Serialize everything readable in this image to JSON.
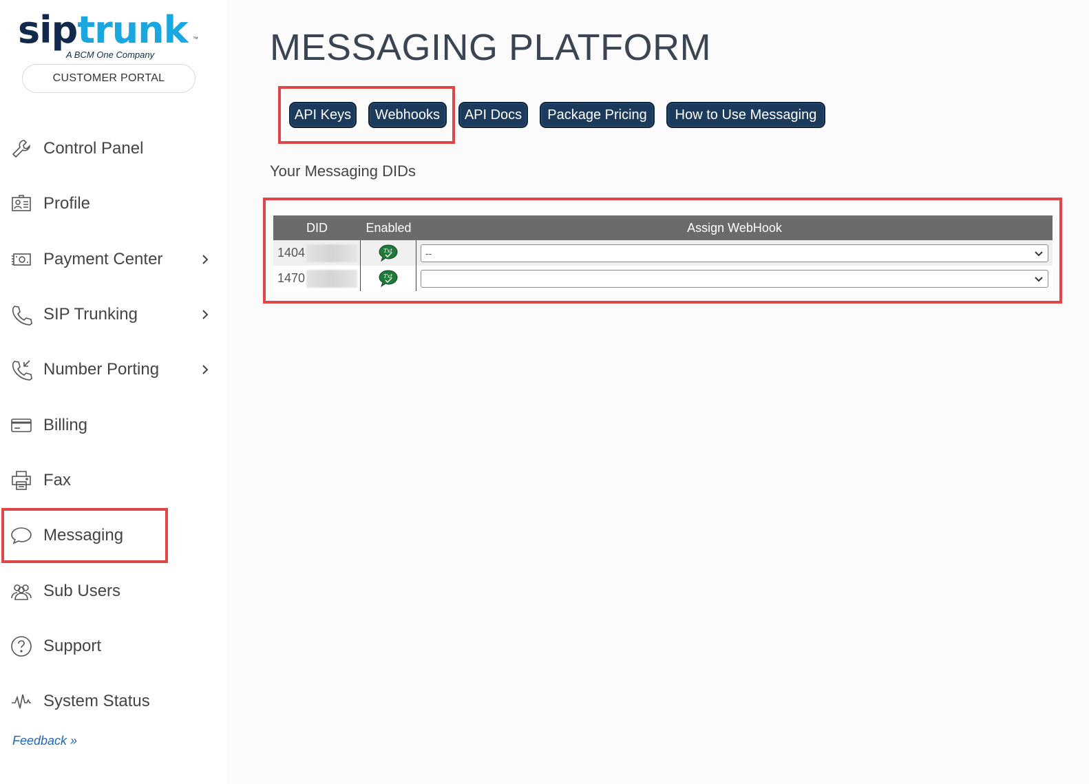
{
  "brand": {
    "logo_sip": "sip",
    "logo_trunk": "trunk",
    "logo_tm": "™",
    "logo_subtitle": "A BCM One Company",
    "portal_label": "CUSTOMER PORTAL"
  },
  "sidebar": {
    "items": [
      {
        "label": "Control Panel",
        "icon": "wrench-icon",
        "has_submenu": false
      },
      {
        "label": "Profile",
        "icon": "id-card-icon",
        "has_submenu": false
      },
      {
        "label": "Payment Center",
        "icon": "money-icon",
        "has_submenu": true
      },
      {
        "label": "SIP Trunking",
        "icon": "phone-icon",
        "has_submenu": true
      },
      {
        "label": "Number Porting",
        "icon": "phone-incoming-icon",
        "has_submenu": true
      },
      {
        "label": "Billing",
        "icon": "credit-card-icon",
        "has_submenu": false
      },
      {
        "label": "Fax",
        "icon": "printer-icon",
        "has_submenu": false
      },
      {
        "label": "Messaging",
        "icon": "chat-bubble-icon",
        "has_submenu": false
      },
      {
        "label": "Sub Users",
        "icon": "users-icon",
        "has_submenu": false
      },
      {
        "label": "Support",
        "icon": "question-icon",
        "has_submenu": false
      },
      {
        "label": "System Status",
        "icon": "pulse-icon",
        "has_submenu": false
      }
    ],
    "feedback_label": "Feedback »"
  },
  "main": {
    "title": "MESSAGING PLATFORM",
    "buttons": [
      {
        "label": "API Keys"
      },
      {
        "label": "Webhooks"
      },
      {
        "label": "API Docs"
      },
      {
        "label": "Package Pricing"
      },
      {
        "label": "How to Use Messaging"
      }
    ],
    "section_label": "Your Messaging DIDs",
    "table": {
      "headers": {
        "did": "DID",
        "enabled": "Enabled",
        "hook": "Assign WebHook"
      },
      "rows": [
        {
          "did": "1404",
          "enabled_icon": "txt-enabled-icon",
          "hook_value": "--"
        },
        {
          "did": "1470",
          "enabled_icon": "txt-enabled-icon",
          "hook_value": ""
        }
      ]
    }
  },
  "colors": {
    "brand_navy": "#13294b",
    "brand_blue": "#1aa7e0",
    "button_bg": "#1b3a5c",
    "table_header": "#6b6b6b",
    "highlight_red": "#e04646",
    "txt_icon_green": "#1f7a3a",
    "feedback_link": "#1f66b0"
  }
}
